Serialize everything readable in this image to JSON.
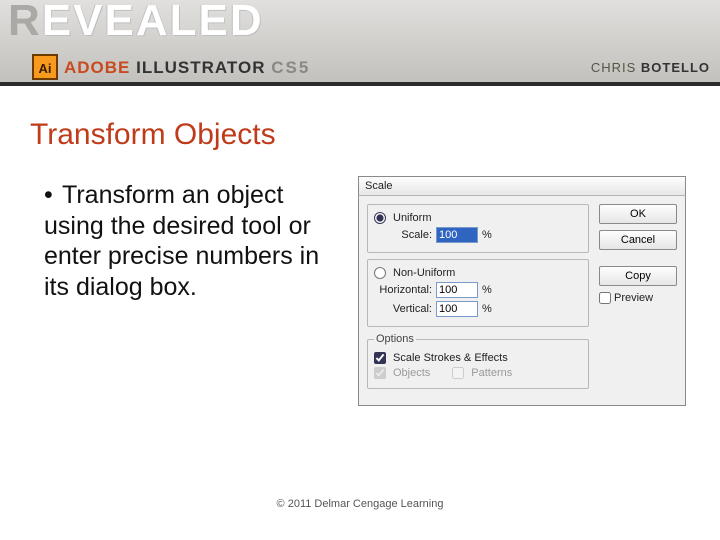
{
  "banner": {
    "revealed_outline": "R",
    "revealed_fill": "EVEALED",
    "product_adobe": "ADOBE",
    "product_name": " ILLUSTRATOR ",
    "product_ver": "CS5",
    "ai_badge": "Ai",
    "author_first": "CHRIS ",
    "author_last": "BOTELLO"
  },
  "slide": {
    "title": "Transform Objects",
    "bullet": "Transform an object using the desired tool or enter precise numbers in its dialog box."
  },
  "dialog": {
    "title": "Scale",
    "uniform": {
      "radio_label": "Uniform",
      "scale_label": "Scale:",
      "scale_value": "100",
      "unit": "%"
    },
    "nonuniform": {
      "radio_label": "Non-Uniform",
      "h_label": "Horizontal:",
      "h_value": "100",
      "v_label": "Vertical:",
      "v_value": "100",
      "unit": "%"
    },
    "options": {
      "legend": "Options",
      "strokes_label": "Scale Strokes & Effects",
      "objects_label": "Objects",
      "patterns_label": "Patterns"
    },
    "buttons": {
      "ok": "OK",
      "cancel": "Cancel",
      "copy": "Copy",
      "preview": "Preview"
    }
  },
  "footer": "© 2011 Delmar Cengage Learning"
}
